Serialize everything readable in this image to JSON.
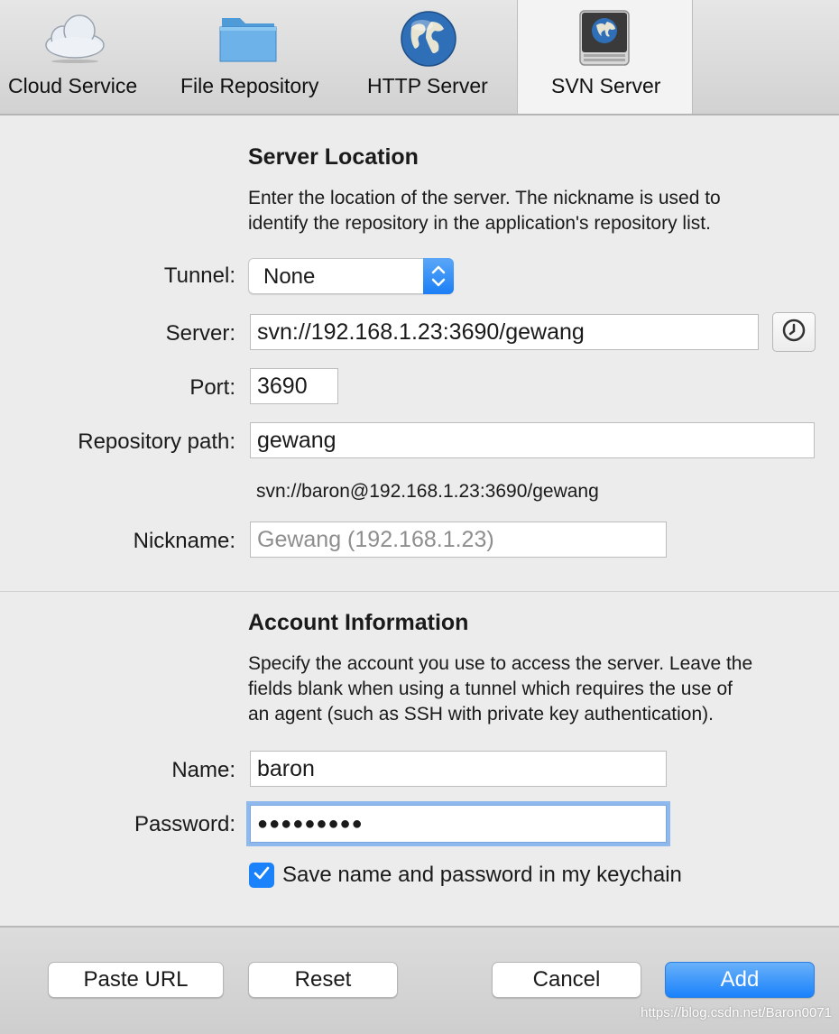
{
  "toolbar": {
    "tabs": [
      {
        "label": "Cloud Service",
        "icon": "cloud-icon"
      },
      {
        "label": "File Repository",
        "icon": "folder-icon"
      },
      {
        "label": "HTTP Server",
        "icon": "globe-icon"
      },
      {
        "label": "SVN Server",
        "icon": "svn-disk-icon",
        "selected": true
      }
    ]
  },
  "server_location": {
    "title": "Server Location",
    "description_line1": "Enter the location of the server. The nickname is used to",
    "description_line2": "identify the repository in the application's repository list.",
    "tunnel_label": "Tunnel:",
    "tunnel_value": "None",
    "server_label": "Server:",
    "server_value": "svn://192.168.1.23:3690/gewang",
    "port_label": "Port:",
    "port_value": "3690",
    "repo_path_label": "Repository path:",
    "repo_path_value": "gewang",
    "resolved_url": "svn://baron@192.168.1.23:3690/gewang",
    "nickname_label": "Nickname:",
    "nickname_placeholder": "Gewang (192.168.1.23)"
  },
  "account": {
    "title": "Account Information",
    "description_line1": "Specify the account you use to access the server. Leave the",
    "description_line2": "fields blank when using a tunnel which requires the use of",
    "description_line3": "an agent (such as SSH with private key authentication).",
    "name_label": "Name:",
    "name_value": "baron",
    "password_label": "Password:",
    "password_value": "●●●●●●●●●",
    "keychain_label": "Save name and password in my keychain",
    "keychain_checked": true
  },
  "footer": {
    "paste_url": "Paste URL",
    "reset": "Reset",
    "cancel": "Cancel",
    "add": "Add"
  },
  "watermark": "https://blog.csdn.net/Baron0071",
  "colors": {
    "accent": "#1a82fb",
    "focus_ring": "#8fb8ec"
  }
}
